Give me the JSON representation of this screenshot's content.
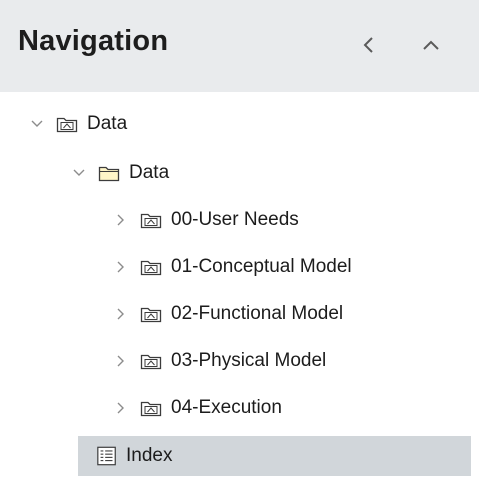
{
  "header": {
    "title": "Navigation",
    "collapse_left_icon": "chevron-left-icon",
    "collapse_up_icon": "chevron-up-icon"
  },
  "tree": {
    "root": {
      "label": "Data",
      "expanded": true,
      "icon": "package-folder-icon"
    },
    "child": {
      "label": "Data",
      "expanded": true,
      "icon": "folder-icon"
    },
    "items": [
      {
        "label": "00-User Needs",
        "expanded": false,
        "icon": "package-folder-icon"
      },
      {
        "label": "01-Conceptual Model",
        "expanded": false,
        "icon": "package-folder-icon"
      },
      {
        "label": "02-Functional Model",
        "expanded": false,
        "icon": "package-folder-icon"
      },
      {
        "label": "03-Physical Model",
        "expanded": false,
        "icon": "package-folder-icon"
      },
      {
        "label": "04-Execution",
        "expanded": false,
        "icon": "package-folder-icon"
      }
    ],
    "index": {
      "label": "Index",
      "selected": true,
      "icon": "document-icon"
    }
  },
  "colors": {
    "header_bg": "#e9ebed",
    "selected_bg": "#d1d6da",
    "icon_stroke": "#3c3c3c",
    "folder_fill": "#fff6c8"
  }
}
